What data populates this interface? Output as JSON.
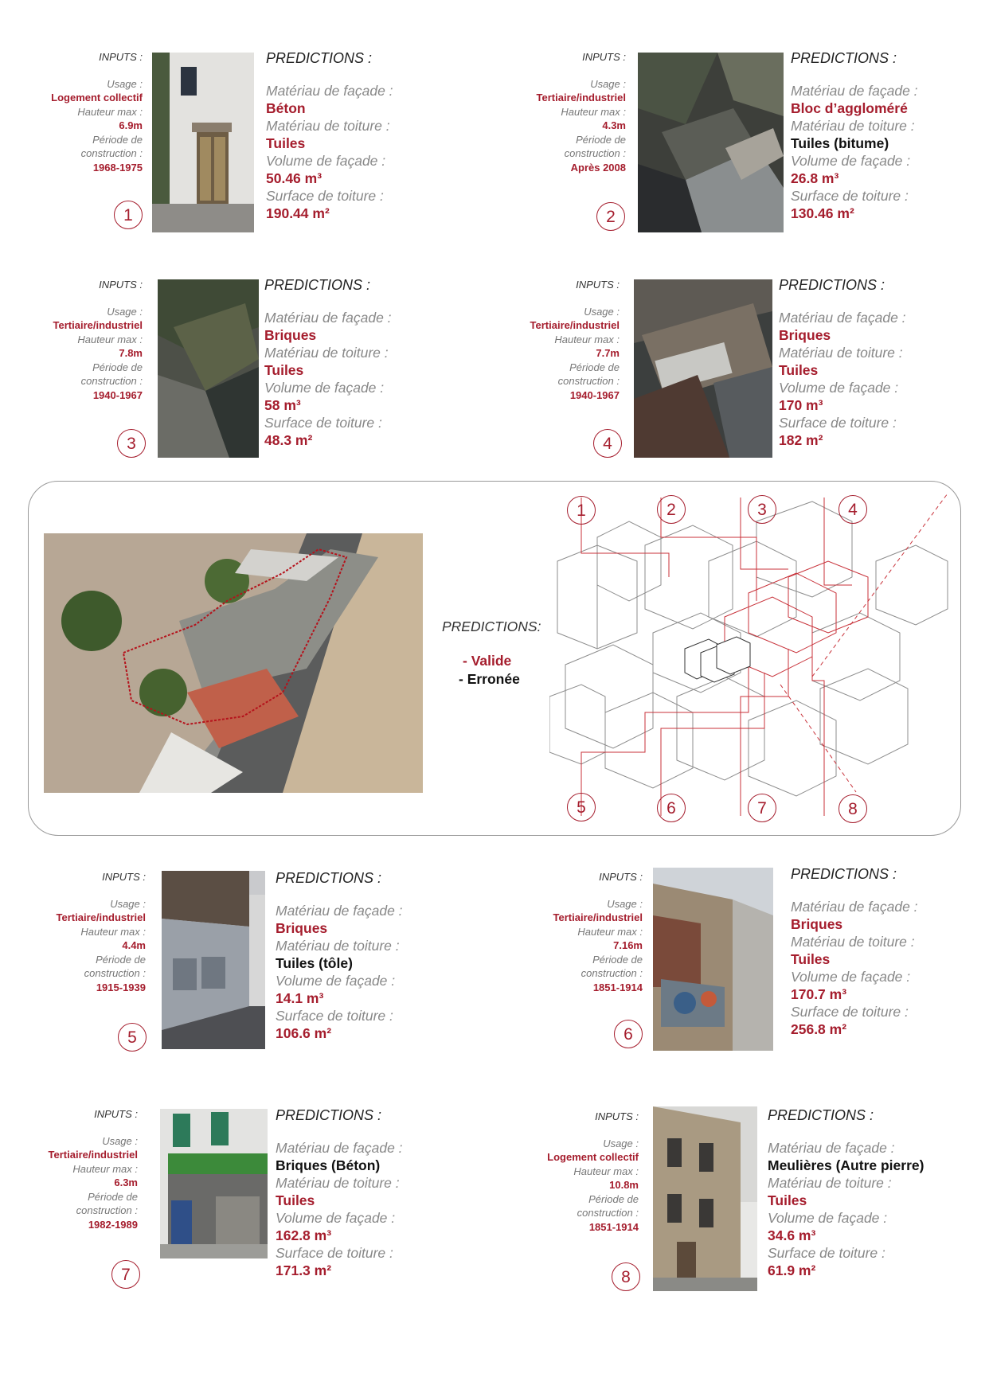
{
  "cards": [
    {
      "number": "1",
      "inputs_title": "INPUTS :",
      "usage_label": "Usage :",
      "usage": "Logement collectif",
      "height_label": "Hauteur max :",
      "height": "6.9m",
      "period_label_1": "Période de",
      "period_label_2": "construction :",
      "period": "1968-1975",
      "predictions_title": "PREDICTIONS :",
      "facade_label": "Matériau de façade :",
      "facade": "Béton",
      "roof_label": "Matériau de toiture :",
      "roof": "Tuiles",
      "volume_label": "Volume de façade :",
      "volume": "50.46 m³",
      "surface_label": "Surface de toiture :",
      "surface": "190.44 m²"
    },
    {
      "number": "2",
      "inputs_title": "INPUTS :",
      "usage_label": "Usage :",
      "usage": "Tertiaire/industriel",
      "height_label": "Hauteur max :",
      "height": "4.3m",
      "period_label_1": "Période de",
      "period_label_2": "construction :",
      "period": "Après 2008",
      "predictions_title": "PREDICTIONS :",
      "facade_label": "Matériau de façade :",
      "facade": "Bloc d’aggloméré",
      "roof_label": "Matériau de toiture :",
      "roof": "Tuiles (bitume)",
      "volume_label": "Volume de façade :",
      "volume": "26.8 m³",
      "surface_label": "Surface de toiture :",
      "surface": "130.46 m²"
    },
    {
      "number": "3",
      "inputs_title": "INPUTS :",
      "usage_label": "Usage :",
      "usage": "Tertiaire/industriel",
      "height_label": "Hauteur max :",
      "height": "7.8m",
      "period_label_1": "Période de",
      "period_label_2": "construction :",
      "period": "1940-1967",
      "predictions_title": "PREDICTIONS :",
      "facade_label": "Matériau de façade :",
      "facade": "Briques",
      "roof_label": "Matériau de toiture :",
      "roof": "Tuiles",
      "volume_label": "Volume de façade :",
      "volume": "58 m³",
      "surface_label": "Surface de toiture :",
      "surface": "48.3 m²"
    },
    {
      "number": "4",
      "inputs_title": "INPUTS :",
      "usage_label": "Usage :",
      "usage": "Tertiaire/industriel",
      "height_label": "Hauteur max :",
      "height": "7.7m",
      "period_label_1": "Période de",
      "period_label_2": "construction :",
      "period": "1940-1967",
      "predictions_title": "PREDICTIONS :",
      "facade_label": "Matériau de façade :",
      "facade": "Briques",
      "roof_label": "Matériau de toiture :",
      "roof": "Tuiles",
      "volume_label": "Volume de façade :",
      "volume": "170 m³",
      "surface_label": "Surface de toiture :",
      "surface": "182 m²"
    },
    {
      "number": "5",
      "inputs_title": "INPUTS :",
      "usage_label": "Usage :",
      "usage": "Tertiaire/industriel",
      "height_label": "Hauteur max :",
      "height": "4.4m",
      "period_label_1": "Période de",
      "period_label_2": "construction :",
      "period": "1915-1939",
      "predictions_title": "PREDICTIONS :",
      "facade_label": "Matériau de façade :",
      "facade": "Briques",
      "roof_label": "Matériau de toiture :",
      "roof": "Tuiles (tôle)",
      "volume_label": "Volume de façade :",
      "volume": "14.1 m³",
      "surface_label": "Surface de toiture :",
      "surface": "106.6 m²"
    },
    {
      "number": "6",
      "inputs_title": "INPUTS :",
      "usage_label": "Usage :",
      "usage": "Tertiaire/industriel",
      "height_label": "Hauteur max :",
      "height": "7.16m",
      "period_label_1": "Période de",
      "period_label_2": "construction :",
      "period": "1851-1914",
      "predictions_title": "PREDICTIONS :",
      "facade_label": "Matériau de façade :",
      "facade": "Briques",
      "roof_label": "Matériau de toiture :",
      "roof": "Tuiles",
      "volume_label": "Volume de façade :",
      "volume": "170.7 m³",
      "surface_label": "Surface de toiture :",
      "surface": "256.8 m²"
    },
    {
      "number": "7",
      "inputs_title": "INPUTS :",
      "usage_label": "Usage :",
      "usage": "Tertiaire/industriel",
      "height_label": "Hauteur max :",
      "height": "6.3m",
      "period_label_1": "Période de",
      "period_label_2": "construction :",
      "period": "1982-1989",
      "predictions_title": "PREDICTIONS :",
      "facade_label": "Matériau de façade :",
      "facade": "Briques (Béton)",
      "roof_label": "Matériau de toiture :",
      "roof": "Tuiles",
      "volume_label": "Volume de façade :",
      "volume": "162.8 m³",
      "surface_label": "Surface de toiture :",
      "surface": "171.3 m²"
    },
    {
      "number": "8",
      "inputs_title": "INPUTS :",
      "usage_label": "Usage :",
      "usage": "Logement collectif",
      "height_label": "Hauteur max :",
      "height": "10.8m",
      "period_label_1": "Période de",
      "period_label_2": "construction :",
      "period": "1851-1914",
      "predictions_title": "PREDICTIONS :",
      "facade_label": "Matériau de façade :",
      "facade": "Meulières (Autre pierre)",
      "roof_label": "Matériau de toiture :",
      "roof": "Tuiles",
      "volume_label": "Volume de façade :",
      "volume": "34.6 m³",
      "surface_label": "Surface de toiture :",
      "surface": "61.9 m²"
    }
  ],
  "prediction_status": {
    "card1": {
      "facade": "valid",
      "roof": "valid"
    },
    "card2": {
      "facade": "valid",
      "roof": "wrong"
    },
    "card5": {
      "roof": "wrong"
    },
    "card7": {
      "facade": "wrong"
    },
    "card8": {
      "facade": "wrong"
    }
  },
  "center": {
    "predictions_title": "PREDICTIONS:",
    "legend_valid": "- Valide",
    "legend_wrong": "- Erronée",
    "diagram_numbers_top": [
      "1",
      "2",
      "3",
      "4"
    ],
    "diagram_numbers_bottom": [
      "5",
      "6",
      "7",
      "8"
    ]
  },
  "colors": {
    "accent": "#a51d2d",
    "text": "#111111",
    "label": "#888888"
  }
}
